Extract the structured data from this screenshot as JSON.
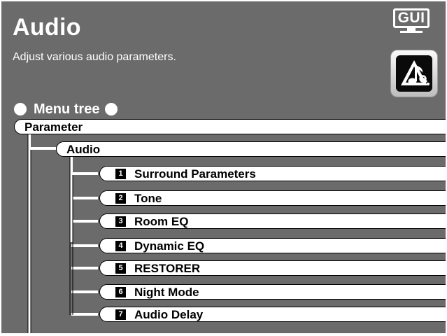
{
  "header": {
    "title": "Audio",
    "subtitle": "Adjust various audio parameters.",
    "gui_badge": "GUI",
    "settings_icon": "audio-settings-icon"
  },
  "menu_tree": {
    "heading": "Menu tree",
    "root": "Parameter",
    "section": "Audio",
    "items": [
      {
        "number": "1",
        "label": "Surround Parameters"
      },
      {
        "number": "2",
        "label": "Tone"
      },
      {
        "number": "3",
        "label": "Room EQ"
      },
      {
        "number": "4",
        "label": "Dynamic EQ"
      },
      {
        "number": "5",
        "label": "RESTORER"
      },
      {
        "number": "6",
        "label": "Night Mode"
      },
      {
        "number": "7",
        "label": "Audio Delay"
      }
    ]
  },
  "colors": {
    "background": "#6b6b6b",
    "pill": "#ffffff",
    "text_on_dark": "#ffffff"
  }
}
